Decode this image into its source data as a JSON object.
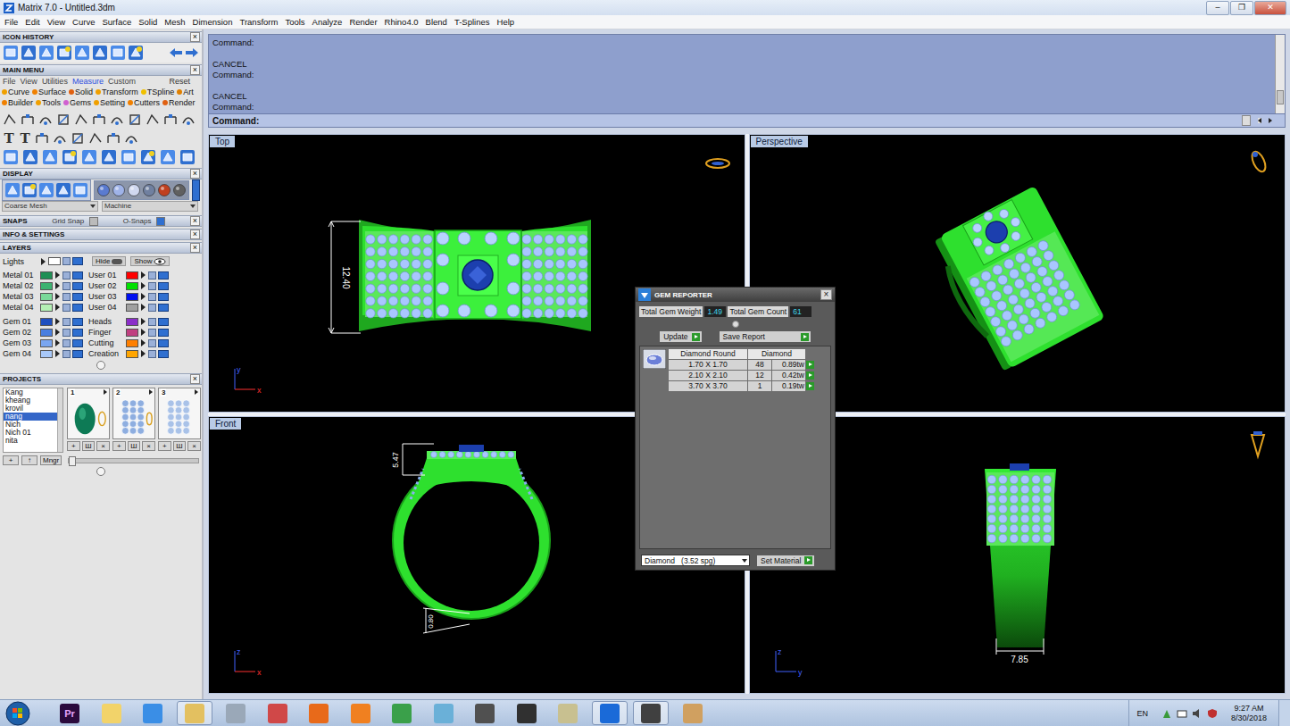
{
  "window": {
    "title": "Matrix 7.0 - Untitled.3dm",
    "controls": [
      "–",
      "❐",
      "✕"
    ]
  },
  "menu": [
    "File",
    "Edit",
    "View",
    "Curve",
    "Surface",
    "Solid",
    "Mesh",
    "Dimension",
    "Transform",
    "Tools",
    "Analyze",
    "Render",
    "Rhino4.0",
    "Blend",
    "T-Splines",
    "Help"
  ],
  "panel": {
    "close": "×",
    "icon_history": {
      "title": "ICON HISTORY"
    },
    "main_menu": {
      "title": "MAIN MENU",
      "tabs": [
        {
          "label": "File",
          "selected": false
        },
        {
          "label": "View",
          "selected": false
        },
        {
          "label": "Utilities",
          "selected": false
        },
        {
          "label": "Measure",
          "selected": true
        },
        {
          "label": "Custom",
          "selected": false
        }
      ],
      "reset": "Reset",
      "categories": [
        {
          "label": "Curve",
          "color": "#f0a000"
        },
        {
          "label": "Surface",
          "color": "#f08000"
        },
        {
          "label": "Solid",
          "color": "#e06010"
        },
        {
          "label": "Transform",
          "color": "#f0a000"
        },
        {
          "label": "TSpline",
          "color": "#f0c000"
        },
        {
          "label": "Art",
          "color": "#e08000"
        },
        {
          "label": "Builder",
          "color": "#f08000"
        },
        {
          "label": "Tools",
          "color": "#f0a000"
        },
        {
          "label": "Gems",
          "color": "#d060d0"
        },
        {
          "label": "Setting",
          "color": "#f0a000"
        },
        {
          "label": "Cutters",
          "color": "#f08000"
        },
        {
          "label": "Render",
          "color": "#e06010"
        }
      ],
      "text_tools": [
        "T",
        "T"
      ]
    },
    "display": {
      "title": "DISPLAY",
      "mesh": "Coarse Mesh",
      "material": "Machine"
    },
    "snaps": {
      "title": "SNAPS",
      "grid": "Grid Snap",
      "osnaps": "O-Snaps"
    },
    "info": {
      "title": "INFO & SETTINGS"
    },
    "layers": {
      "title": "LAYERS",
      "lights": "Lights",
      "hide": "Hide",
      "show": "Show",
      "columns": [
        [
          [
            {
              "name": "Metal 01",
              "color": "#1f8f55"
            },
            {
              "name": "Metal 02",
              "color": "#3cb371"
            },
            {
              "name": "Metal 03",
              "color": "#7ad99a"
            },
            {
              "name": "Metal 04",
              "color": "#b4f0b4"
            }
          ],
          [
            {
              "name": "Gem 01",
              "color": "#1f4fbf"
            },
            {
              "name": "Gem 02",
              "color": "#4a7fe0"
            },
            {
              "name": "Gem 03",
              "color": "#7aa6f0"
            },
            {
              "name": "Gem 04",
              "color": "#a8c8f8"
            }
          ]
        ],
        [
          [
            {
              "name": "User 01",
              "color": "#ff0000"
            },
            {
              "name": "User 02",
              "color": "#00e000"
            },
            {
              "name": "User 03",
              "color": "#0010f0"
            },
            {
              "name": "User 04",
              "color": "#a0a0a0"
            }
          ],
          [
            {
              "name": "Heads",
              "color": "#8b2fc9"
            },
            {
              "name": "Finger",
              "color": "#c04080"
            },
            {
              "name": "Cutting",
              "color": "#ff7f00"
            },
            {
              "name": "Creation",
              "color": "#ffa500"
            }
          ]
        ]
      ]
    },
    "projects": {
      "title": "PROJECTS",
      "items": [
        {
          "label": "Kang",
          "selected": false
        },
        {
          "label": "kheang",
          "selected": false
        },
        {
          "label": "krovil",
          "selected": false
        },
        {
          "label": "nang",
          "selected": true
        },
        {
          "label": "Nich",
          "selected": false
        },
        {
          "label": "Nich 01",
          "selected": false
        },
        {
          "label": "nita",
          "selected": false
        }
      ],
      "thumbs": [
        {
          "number": "1",
          "color": "#0d7a55"
        },
        {
          "number": "2",
          "color": "#8eaee0"
        },
        {
          "number": "3",
          "color": "#a9c2e8"
        }
      ],
      "thumb_actions": [
        "+",
        "Ш",
        "×"
      ],
      "buttons": [
        "+",
        "↑",
        "Mngr"
      ]
    }
  },
  "command": {
    "lines": [
      "Command:",
      "",
      "CANCEL",
      "Command:",
      "",
      "CANCEL",
      "Command:"
    ],
    "prompt": "Command:"
  },
  "viewports": [
    {
      "label": "Top",
      "kind": "top",
      "dimensions": [
        "12.40"
      ],
      "axes": [
        {
          "label": "y",
          "color": "#4060ff"
        },
        {
          "label": "x",
          "color": "#ff3030"
        }
      ]
    },
    {
      "label": "Perspective",
      "kind": "perspective",
      "dimensions": [],
      "axes": []
    },
    {
      "label": "Front",
      "kind": "front",
      "dimensions": [
        "5.47",
        "0.80"
      ],
      "axes": [
        {
          "label": "z",
          "color": "#4060ff"
        },
        {
          "label": "x",
          "color": "#ff3030"
        }
      ]
    },
    {
      "kind": "side",
      "dimensions": [
        "7.85"
      ],
      "axes": [
        {
          "label": "z",
          "color": "#4060ff"
        },
        {
          "label": "y",
          "color": "#4060ff"
        }
      ]
    }
  ],
  "gem_reporter": {
    "title": "GEM REPORTER",
    "close": "×",
    "weight_label": "Total Gem Weight",
    "weight": "1.49",
    "count_label": "Total Gem Count",
    "count": "61",
    "update": "Update",
    "save": "Save Report",
    "columns": [
      "Diamond Round",
      "Diamond"
    ],
    "rows": [
      {
        "size": "1.70 X 1.70",
        "count": "48",
        "weight": "0.89tw"
      },
      {
        "size": "2.10 X 2.10",
        "count": "12",
        "weight": "0.42tw"
      },
      {
        "size": "3.70 X 3.70",
        "count": "1",
        "weight": "0.19tw"
      }
    ],
    "material": "Diamond   (3.52 spg)",
    "set_material": "Set Material"
  },
  "taskbar": {
    "apps": [
      {
        "glyph": "Pr",
        "color": "#2b0a3d",
        "active": false
      },
      {
        "color": "#f2d36a",
        "active": false
      },
      {
        "color": "#3a8ee6",
        "active": false
      },
      {
        "color": "#e3c060",
        "active": true
      },
      {
        "color": "#9aa8b8",
        "active": false
      },
      {
        "color": "#d04848",
        "active": false
      },
      {
        "color": "#e86a1a",
        "active": false
      },
      {
        "color": "#f08020",
        "active": false
      },
      {
        "color": "#3aa04a",
        "active": false
      },
      {
        "color": "#6ab0d8",
        "active": false
      },
      {
        "color": "#505050",
        "active": false
      },
      {
        "color": "#303030",
        "active": false
      },
      {
        "color": "#c8c090",
        "active": false
      },
      {
        "color": "#1a6ad8",
        "active": true
      },
      {
        "color": "#404040",
        "active": true
      },
      {
        "color": "#d0a060",
        "active": false
      }
    ],
    "language": "EN",
    "time": "9:27 AM",
    "date": "8/30/2018"
  }
}
